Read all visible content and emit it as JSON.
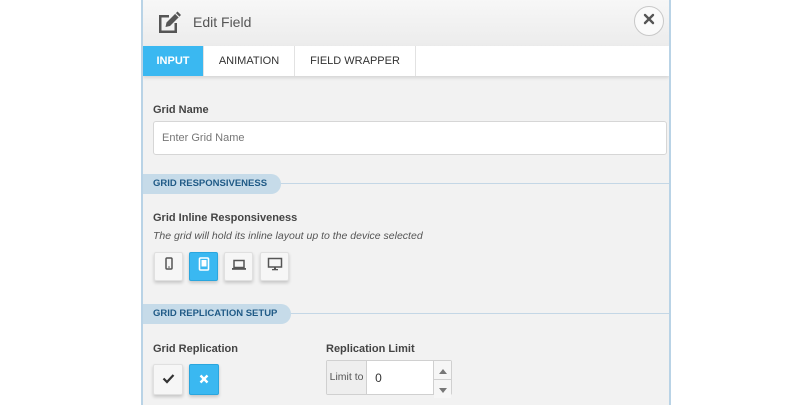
{
  "header": {
    "title": "Edit Field",
    "edit_icon": "edit-icon",
    "close_icon": "close-icon"
  },
  "tabs": [
    {
      "label": "INPUT",
      "active": true
    },
    {
      "label": "ANIMATION",
      "active": false
    },
    {
      "label": "FIELD WRAPPER",
      "active": false
    }
  ],
  "grid_name": {
    "label": "Grid Name",
    "placeholder": "Enter Grid Name",
    "value": ""
  },
  "responsiveness": {
    "section_title": "GRID RESPONSIVENESS",
    "label": "Grid Inline Responsiveness",
    "description": "The grid will hold its inline layout up to the device selected",
    "devices": [
      {
        "icon": "mobile-icon",
        "active": false
      },
      {
        "icon": "tablet-icon",
        "active": true
      },
      {
        "icon": "laptop-icon",
        "active": false
      },
      {
        "icon": "desktop-icon",
        "active": false
      }
    ]
  },
  "replication": {
    "section_title": "GRID REPLICATION SETUP",
    "label": "Grid Replication",
    "toggle_on_icon": "check-icon",
    "toggle_off_icon": "x-icon",
    "selected": "off",
    "limit_label": "Replication Limit",
    "limit_addon": "Limit to",
    "limit_value": "0"
  },
  "colors": {
    "accent": "#3ab8f1",
    "section_pill": "#c6dbe9",
    "section_text": "#1f5a86",
    "panel_border": "#b9d3e6"
  }
}
